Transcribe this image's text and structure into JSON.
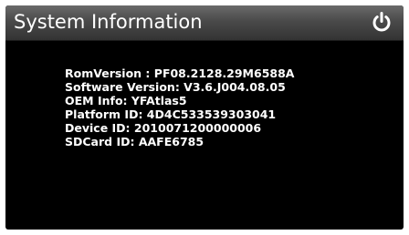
{
  "header": {
    "title": "System Information",
    "power_icon": "power-icon"
  },
  "info": {
    "lines": [
      "RomVersion : PF08.2128.29M6588A",
      "Software Version: V3.6.J004.08.05",
      "OEM Info: YFAtlas5",
      "Platform ID: 4D4C533539303041",
      "Device ID: 2010071200000006",
      "SDCard ID: AAFE6785"
    ]
  },
  "colors": {
    "background": "#000000",
    "title_bar": "#4a4a4a",
    "text": "#ffffff"
  }
}
